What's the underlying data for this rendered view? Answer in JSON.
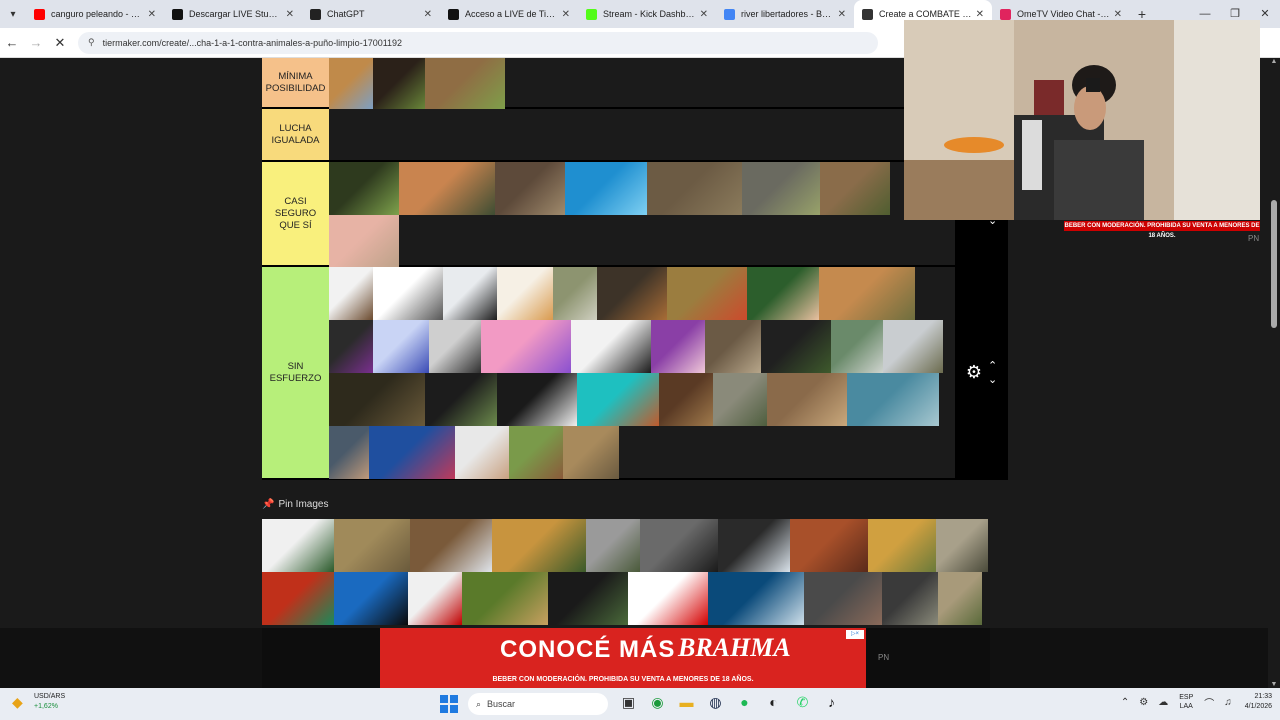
{
  "browser": {
    "tabs": [
      {
        "title": "canguro peleando - YouTube",
        "favicon_color": "#ff0000",
        "active": false
      },
      {
        "title": "Descargar LIVE Studio | TikTok",
        "favicon_color": "#111111",
        "active": false
      },
      {
        "title": "ChatGPT",
        "favicon_color": "#222222",
        "active": false
      },
      {
        "title": "Acceso a LIVE de TikTok",
        "favicon_color": "#111111",
        "active": false
      },
      {
        "title": "Stream - Kick Dashboard",
        "favicon_color": "#53fc18",
        "active": false
      },
      {
        "title": "river libertadores - Buscar",
        "favicon_color": "#4285f4",
        "active": false
      },
      {
        "title": "Create a COMBATE 1 A 1",
        "favicon_color": "#333333",
        "active": true
      },
      {
        "title": "OmeTV Video Chat - Omegle",
        "favicon_color": "#e0245e",
        "active": false
      }
    ],
    "url": "tiermaker.com/create/...cha-1-a-1-contra-animales-a-puño-limpio-17001192"
  },
  "tiers": [
    {
      "label": "MÍNIMA POSIBILIDAD",
      "color": "#f5c18a",
      "items": [
        {
          "name": "kangaroo",
          "c1": "#c08a4a",
          "c2": "#7aa0c8"
        },
        {
          "name": "rottweiler",
          "c1": "#2b2119",
          "c2": "#6b8a3a"
        },
        {
          "name": "dog",
          "c1": "#8f6d44",
          "c2": "#7ea04a"
        }
      ]
    },
    {
      "label": "LUCHA IGUALADA",
      "color": "#f8da7c",
      "items": []
    },
    {
      "label": "CASI SEGURO QUE SÍ",
      "color": "#f9f07d",
      "items": [
        {
          "name": "chimpanzee",
          "c1": "#2e3a1e",
          "c2": "#7ea24c"
        },
        {
          "name": "cat",
          "c1": "#c9844f",
          "c2": "#3e4d33"
        },
        {
          "name": "walrus",
          "c1": "#5d4a3a",
          "c2": "#a08a6c"
        },
        {
          "name": "dolphin",
          "c1": "#1f8fd0",
          "c2": "#7fd0f2"
        },
        {
          "name": "komodo-dragon",
          "c1": "#6c5b44",
          "c2": "#8b7b5c"
        },
        {
          "name": "donkey",
          "c1": "#6a6a60",
          "c2": "#98a26a"
        },
        {
          "name": "sloth",
          "c1": "#8a6c4a",
          "c2": "#4f5e30"
        },
        {
          "name": "pig",
          "c1": "#e7b3a5",
          "c2": "#bca188"
        }
      ]
    },
    {
      "label": "SIN ESFUERZO",
      "color": "#b7ef7a",
      "items": [
        {
          "name": "chihuahua",
          "c1": "#f2f2f2",
          "c2": "#6b4a2e"
        },
        {
          "name": "cats",
          "c1": "#ffffff",
          "c2": "#555555"
        },
        {
          "name": "penguin",
          "c1": "#e8ebee",
          "c2": "#1c1c1c"
        },
        {
          "name": "hamster",
          "c1": "#f6f0e5",
          "c2": "#d99a4e"
        },
        {
          "name": "goose",
          "c1": "#8d9470",
          "c2": "#cfcfc0"
        },
        {
          "name": "centipede",
          "c1": "#3d3328",
          "c2": "#a86c36"
        },
        {
          "name": "rooster",
          "c1": "#9b7d3f",
          "c2": "#cc4a2c"
        },
        {
          "name": "kid-meme",
          "c1": "#2c5e2c",
          "c2": "#e8c0a0"
        },
        {
          "name": "proboscis-monkey",
          "c1": "#c58a4e",
          "c2": "#6e6e3e"
        },
        {
          "name": "streamer",
          "c1": "#2b2b2b",
          "c2": "#7a2f8f"
        },
        {
          "name": "anime-girl",
          "c1": "#c9d4f5",
          "c2": "#3a4bb5"
        },
        {
          "name": "man",
          "c1": "#cfcfcf",
          "c2": "#2f2f2f"
        },
        {
          "name": "majin-buu",
          "c1": "#f29ac4",
          "c2": "#8a4fd0"
        },
        {
          "name": "scorpion",
          "c1": "#f2f2f2",
          "c2": "#1b1b1b"
        },
        {
          "name": "woman",
          "c1": "#8a3fa6",
          "c2": "#f0c8d8"
        },
        {
          "name": "bird-nest",
          "c1": "#6b5a45",
          "c2": "#b7a68a"
        },
        {
          "name": "bats",
          "c1": "#202020",
          "c2": "#3e5a2c"
        },
        {
          "name": "shoebill",
          "c1": "#6a8a6a",
          "c2": "#cfd4cf"
        },
        {
          "name": "pelican",
          "c1": "#c9cdd0",
          "c2": "#6b6b4e"
        },
        {
          "name": "frog",
          "c1": "#2e2a1c",
          "c2": "#6a5a3a"
        },
        {
          "name": "vulture",
          "c1": "#1c1c1c",
          "c2": "#6c8a4c"
        },
        {
          "name": "skunk",
          "c1": "#1a1a1a",
          "c2": "#f0f0f0"
        },
        {
          "name": "octopus",
          "c1": "#1ec0c0",
          "c2": "#c05a2c"
        },
        {
          "name": "beaver",
          "c1": "#5a3a24",
          "c2": "#a07a4c"
        },
        {
          "name": "squirrel",
          "c1": "#8a8a7a",
          "c2": "#4e5e3e"
        },
        {
          "name": "armadillo",
          "c1": "#8a6a4a",
          "c2": "#c9a87c"
        },
        {
          "name": "manatee",
          "c1": "#4a8aa0",
          "c2": "#a8c8d0"
        },
        {
          "name": "boy",
          "c1": "#4a5a6a",
          "c2": "#c09a7a"
        },
        {
          "name": "squid",
          "c1": "#1f4f9f",
          "c2": "#c03a5a"
        },
        {
          "name": "child",
          "c1": "#e8e8e8",
          "c2": "#c8a080"
        },
        {
          "name": "goat",
          "c1": "#7a9a4a",
          "c2": "#8a5a3a"
        },
        {
          "name": "hyena",
          "c1": "#a88a5c",
          "c2": "#6a5a40"
        }
      ]
    }
  ],
  "pin_images_label": "Pin Images",
  "pool_items": [
    {
      "name": "panda",
      "c1": "#f0f0f0",
      "c2": "#2a5a2a"
    },
    {
      "name": "cobra",
      "c1": "#a08a5a",
      "c2": "#6a5a3c"
    },
    {
      "name": "hawk",
      "c1": "#7a5a3a",
      "c2": "#dfe4ea"
    },
    {
      "name": "jaguar",
      "c1": "#c8943e",
      "c2": "#3a5a2a"
    },
    {
      "name": "koala",
      "c1": "#9a9a9a",
      "c2": "#4a5a3a"
    },
    {
      "name": "raccoon",
      "c1": "#6a6a6a",
      "c2": "#1a1a1a"
    },
    {
      "name": "ostrich",
      "c1": "#2a2a2a",
      "c2": "#d9e2ea"
    },
    {
      "name": "orangutan",
      "c1": "#a8502a",
      "c2": "#5a2a1a"
    },
    {
      "name": "lion",
      "c1": "#d0a040",
      "c2": "#6a7a3a"
    },
    {
      "name": "lynx",
      "c1": "#a8a08a",
      "c2": "#4a4a3a"
    },
    {
      "name": "mantis-shrimp",
      "c1": "#c0301a",
      "c2": "#1a8a5a"
    },
    {
      "name": "orca",
      "c1": "#1a6ac0",
      "c2": "#0a0a0a"
    },
    {
      "name": "streamer-peru",
      "c1": "#f0f0f0",
      "c2": "#c00000"
    },
    {
      "name": "monkey",
      "c1": "#5a7a2a",
      "c2": "#c8a060"
    },
    {
      "name": "bear",
      "c1": "#1a1a1a",
      "c2": "#4a6a3a"
    },
    {
      "name": "streamer-peru-2",
      "c1": "#ffffff",
      "c2": "#d40000"
    },
    {
      "name": "manta-ray",
      "c1": "#0a4a7a",
      "c2": "#cfe0ea"
    },
    {
      "name": "sea-lion",
      "c1": "#4a4a4a",
      "c2": "#8a6a5a"
    },
    {
      "name": "platypus",
      "c1": "#3a3a3a",
      "c2": "#8a8a7a"
    },
    {
      "name": "rabbit",
      "c1": "#a89a7a",
      "c2": "#5a6a3a"
    }
  ],
  "ad": {
    "cta": "CONOCÉ MÁS",
    "brand": "BRAHMA",
    "legal": "BEBER CON MODERACIÓN. PROHIBIDA SU VENTA A MENORES DE 18 AÑOS.",
    "badge": "▷×"
  },
  "webcam": {
    "caption": "BEBER CON MODERACIÓN. PROHIBIDA SU VENTA A MENORES DE 18 AÑOS.",
    "overlay_tag": "PN"
  },
  "taskbar": {
    "ticker_name": "USD/ARS",
    "ticker_change": "+1,62%",
    "search_placeholder": "Buscar",
    "lang_top": "ESP",
    "lang_bottom": "LAA",
    "time": "21:33",
    "date": "4/1/2026"
  }
}
